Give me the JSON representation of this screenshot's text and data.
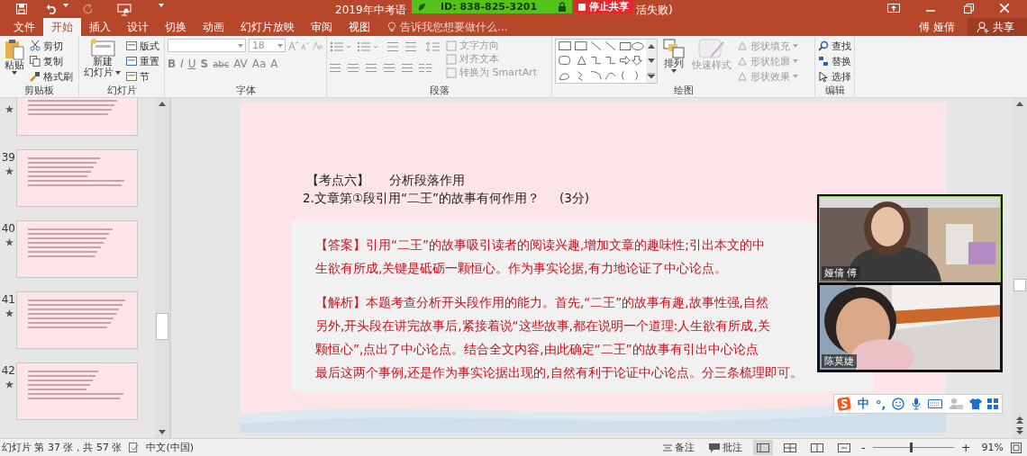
{
  "title_bar": {
    "title_start": "2019年中考语",
    "title_end": "活失败)"
  },
  "share_bar": {
    "meeting_id": "ID: 838-825-3201",
    "stop_button": "停止共享"
  },
  "tabs": [
    {
      "label": "文件",
      "selected": false
    },
    {
      "label": "开始",
      "selected": true
    },
    {
      "label": "插入",
      "selected": false
    },
    {
      "label": "设计",
      "selected": false
    },
    {
      "label": "切换",
      "selected": false
    },
    {
      "label": "动画",
      "selected": false
    },
    {
      "label": "幻灯片放映",
      "selected": false
    },
    {
      "label": "审阅",
      "selected": false
    },
    {
      "label": "视图",
      "selected": false
    }
  ],
  "tell_me": {
    "placeholder": "告诉我您想要做什么..."
  },
  "account": {
    "user": "傅 娅倩",
    "share": "共享"
  },
  "clipboard": {
    "label": "剪贴板",
    "paste": "粘贴",
    "commands": [
      "剪切",
      "复制",
      "格式刷"
    ]
  },
  "slides_group": {
    "label": "幻灯片",
    "new_slide": [
      "新建",
      "幻灯片"
    ],
    "commands": [
      "版式",
      "重置",
      "节"
    ]
  },
  "font": {
    "label": "字体",
    "font_size": "18",
    "format_buttons": [
      "B",
      "I",
      "U",
      "S",
      "abc",
      "AV",
      "Aa",
      "A"
    ]
  },
  "paragraph": {
    "label": "段落",
    "commands": [
      "文字方向",
      "对齐文本",
      "转换为 SmartArt"
    ]
  },
  "drawing": {
    "label": "绘图",
    "arrange": "排列",
    "quick_styles": {
      "label": "快速样式",
      "disabled": true
    },
    "shape_commands": [
      {
        "label": "形状填充",
        "disabled": true
      },
      {
        "label": "形状轮廓",
        "disabled": true
      },
      {
        "label": "形状效果",
        "disabled": true
      }
    ]
  },
  "editing": {
    "label": "编辑",
    "commands": [
      "查找",
      "替换",
      "选择"
    ]
  },
  "thumbnails": [
    {
      "selected": false
    },
    {
      "number": "39",
      "selected": false
    },
    {
      "number": "40",
      "selected": false
    },
    {
      "number": "41",
      "selected": false
    },
    {
      "number": "42",
      "selected": false
    }
  ],
  "slide": {
    "topic_tag": "【考点六】",
    "topic": "分析段落作用",
    "question": "2.文章第①段引用“二王”的故事有何作用？",
    "score": "(3分)",
    "answer_lines": [
      "【答案】引用“二王”的故事吸引读者的阅读兴趣,增加文章的趣味性;引出本文的中",
      "生欲有所成,关键是砥砺一颗恒心。作为事实论据,有力地论证了中心论点。"
    ],
    "analysis_lines": [
      "【解析】本题考查分析开头段作用的能力。首先,“二王”的故事有趣,故事性强,自然",
      "另外,开头段在讲完故事后,紧接着说“这些故事,都在说明一个道理:人生欲有所成,关",
      "颗恒心”,点出了中心论点。结合全文内容,由此确定“二王”的故事有引出中心论点",
      "最后这两个事例,还是作为事实论据出现的,自然有利于论证中心论点。分三条梳理即可。"
    ]
  },
  "video": {
    "participants": [
      {
        "name": "娅倩 傅",
        "speaking": true
      },
      {
        "name": "陈莫婕",
        "speaking": false
      }
    ]
  },
  "ime_toolbar": {
    "mode": "中",
    "punctuation": "°,"
  },
  "status_bar": {
    "slide_count": "幻灯片 第 37 张，共 57 张",
    "language": "中文(中国)",
    "notes": "备注",
    "comments": "批注",
    "views": [
      {
        "selected": true
      },
      {
        "selected": false
      },
      {
        "selected": false
      },
      {
        "selected": false
      }
    ],
    "zoom_out": "-",
    "zoom_in": "+",
    "zoom": {
      "level": 0.46
    },
    "zoom_text": "91%"
  }
}
